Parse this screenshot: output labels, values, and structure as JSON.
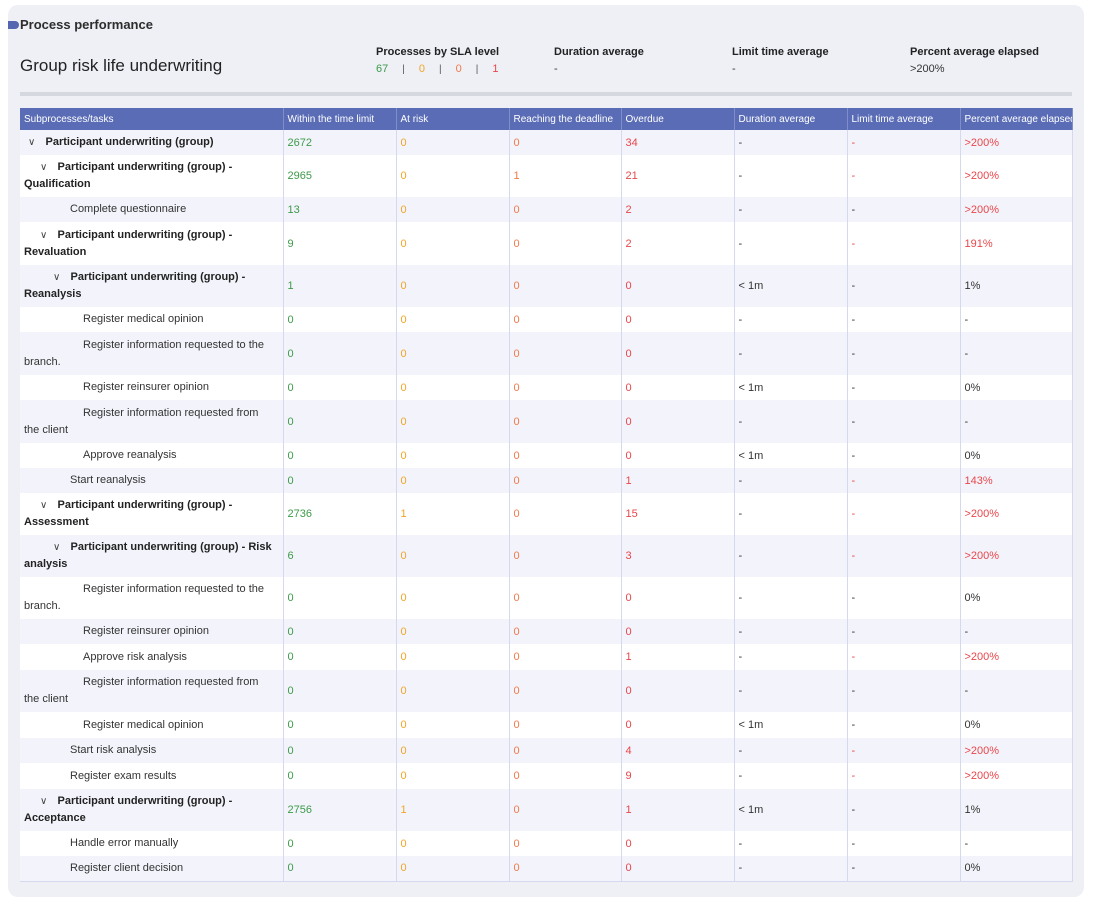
{
  "panel_title": "Process performance",
  "process_name": "Group risk life underwriting",
  "summary": {
    "sla_label": "Processes by SLA level",
    "sla_values": [
      "67",
      "0",
      "0",
      "1"
    ],
    "sla_separator": "|",
    "duration_label": "Duration average",
    "duration_value": "-",
    "limit_label": "Limit time average",
    "limit_value": "-",
    "percent_label": "Percent average elapsed",
    "percent_value": ">200%"
  },
  "colors": {
    "header_bg": "#5a6cb6",
    "within": "#3d9a4a",
    "at_risk": "#f0a526",
    "reaching": "#ef7a4a",
    "overdue": "#e8464a"
  },
  "columns": [
    "Subprocesses/tasks",
    "Within the time limit",
    "At risk",
    "Reaching the deadline",
    "Overdue",
    "Duration average",
    "Limit time average",
    "Percent average elapsed"
  ],
  "rows": [
    {
      "level": 0,
      "group": true,
      "name1": "Participant underwriting (group)",
      "name2": "",
      "within": "2672",
      "risk": "0",
      "reach": "0",
      "overdue": "34",
      "dur": "-",
      "limit": "-",
      "pct": ">200%",
      "limit_red": true,
      "pct_red": true,
      "h": 25
    },
    {
      "level": 1,
      "group": true,
      "name1": "Participant underwriting (group) -",
      "name2": "Qualification",
      "within": "2965",
      "risk": "0",
      "reach": "1",
      "overdue": "21",
      "dur": "-",
      "limit": "-",
      "pct": ">200%",
      "limit_red": true,
      "pct_red": true,
      "h": 42
    },
    {
      "level": 2,
      "group": false,
      "name1": "Complete questionnaire",
      "name2": "",
      "within": "13",
      "risk": "0",
      "reach": "0",
      "overdue": "2",
      "dur": "-",
      "limit": "-",
      "pct": ">200%",
      "limit_red": false,
      "pct_red": true,
      "h": 25
    },
    {
      "level": 1,
      "group": true,
      "name1": "Participant underwriting (group) -",
      "name2": "Revaluation",
      "within": "9",
      "risk": "0",
      "reach": "0",
      "overdue": "2",
      "dur": "-",
      "limit": "-",
      "pct": "191%",
      "limit_red": true,
      "pct_red": true,
      "h": 43
    },
    {
      "level": 2,
      "group": true,
      "name1": "Participant underwriting (group) -",
      "name2": "Reanalysis",
      "within": "1",
      "risk": "0",
      "reach": "0",
      "overdue": "0",
      "dur": "< 1m",
      "limit": "-",
      "pct": "1%",
      "limit_red": false,
      "pct_red": false,
      "h": 42
    },
    {
      "level": 3,
      "group": false,
      "name1": "Register medical opinion",
      "name2": "",
      "within": "0",
      "risk": "0",
      "reach": "0",
      "overdue": "0",
      "dur": "-",
      "limit": "-",
      "pct": "-",
      "limit_red": false,
      "pct_red": false,
      "h": 25
    },
    {
      "level": 3,
      "group": false,
      "name1": "Register information requested to the",
      "name2": "branch.",
      "within": "0",
      "risk": "0",
      "reach": "0",
      "overdue": "0",
      "dur": "-",
      "limit": "-",
      "pct": "-",
      "limit_red": false,
      "pct_red": false,
      "h": 43
    },
    {
      "level": 3,
      "group": false,
      "name1": "Register reinsurer opinion",
      "name2": "",
      "within": "0",
      "risk": "0",
      "reach": "0",
      "overdue": "0",
      "dur": "< 1m",
      "limit": "-",
      "pct": "0%",
      "limit_red": false,
      "pct_red": false,
      "h": 25
    },
    {
      "level": 3,
      "group": false,
      "name1": "Register information requested from",
      "name2": "the client",
      "within": "0",
      "risk": "0",
      "reach": "0",
      "overdue": "0",
      "dur": "-",
      "limit": "-",
      "pct": "-",
      "limit_red": false,
      "pct_red": false,
      "h": 43
    },
    {
      "level": 3,
      "group": false,
      "name1": "Approve reanalysis",
      "name2": "",
      "within": "0",
      "risk": "0",
      "reach": "0",
      "overdue": "0",
      "dur": "< 1m",
      "limit": "-",
      "pct": "0%",
      "limit_red": false,
      "pct_red": false,
      "h": 25
    },
    {
      "level": 2,
      "group": false,
      "name1": "Start reanalysis",
      "name2": "",
      "within": "0",
      "risk": "0",
      "reach": "0",
      "overdue": "1",
      "dur": "-",
      "limit": "-",
      "pct": "143%",
      "limit_red": true,
      "pct_red": true,
      "h": 25
    },
    {
      "level": 1,
      "group": true,
      "name1": "Participant underwriting (group) -",
      "name2": "Assessment",
      "within": "2736",
      "risk": "1",
      "reach": "0",
      "overdue": "15",
      "dur": "-",
      "limit": "-",
      "pct": ">200%",
      "limit_red": true,
      "pct_red": true,
      "h": 42
    },
    {
      "level": 2,
      "group": true,
      "name1": "Participant underwriting (group) - Risk",
      "name2": "analysis",
      "within": "6",
      "risk": "0",
      "reach": "0",
      "overdue": "3",
      "dur": "-",
      "limit": "-",
      "pct": ">200%",
      "limit_red": true,
      "pct_red": true,
      "h": 42
    },
    {
      "level": 3,
      "group": false,
      "name1": "Register information requested to the",
      "name2": "branch.",
      "within": "0",
      "risk": "0",
      "reach": "0",
      "overdue": "0",
      "dur": "-",
      "limit": "-",
      "pct": "0%",
      "limit_red": false,
      "pct_red": false,
      "h": 42
    },
    {
      "level": 3,
      "group": false,
      "name1": "Register reinsurer opinion",
      "name2": "",
      "within": "0",
      "risk": "0",
      "reach": "0",
      "overdue": "0",
      "dur": "-",
      "limit": "-",
      "pct": "-",
      "limit_red": false,
      "pct_red": false,
      "h": 25
    },
    {
      "level": 3,
      "group": false,
      "name1": "Approve risk analysis",
      "name2": "",
      "within": "0",
      "risk": "0",
      "reach": "0",
      "overdue": "1",
      "dur": "-",
      "limit": "-",
      "pct": ">200%",
      "limit_red": true,
      "pct_red": true,
      "h": 26
    },
    {
      "level": 3,
      "group": false,
      "name1": "Register information requested from",
      "name2": "the client",
      "within": "0",
      "risk": "0",
      "reach": "0",
      "overdue": "0",
      "dur": "-",
      "limit": "-",
      "pct": "-",
      "limit_red": false,
      "pct_red": false,
      "h": 42
    },
    {
      "level": 3,
      "group": false,
      "name1": "Register medical opinion",
      "name2": "",
      "within": "0",
      "risk": "0",
      "reach": "0",
      "overdue": "0",
      "dur": "< 1m",
      "limit": "-",
      "pct": "0%",
      "limit_red": false,
      "pct_red": false,
      "h": 26
    },
    {
      "level": 2,
      "group": false,
      "name1": "Start risk analysis",
      "name2": "",
      "within": "0",
      "risk": "0",
      "reach": "0",
      "overdue": "4",
      "dur": "-",
      "limit": "-",
      "pct": ">200%",
      "limit_red": true,
      "pct_red": true,
      "h": 25
    },
    {
      "level": 2,
      "group": false,
      "name1": "Register exam results",
      "name2": "",
      "within": "0",
      "risk": "0",
      "reach": "0",
      "overdue": "9",
      "dur": "-",
      "limit": "-",
      "pct": ">200%",
      "limit_red": true,
      "pct_red": true,
      "h": 26
    },
    {
      "level": 1,
      "group": true,
      "name1": "Participant underwriting (group) -",
      "name2": "Acceptance",
      "within": "2756",
      "risk": "1",
      "reach": "0",
      "overdue": "1",
      "dur": "< 1m",
      "limit": "-",
      "pct": "1%",
      "limit_red": false,
      "pct_red": false,
      "h": 42
    },
    {
      "level": 2,
      "group": false,
      "name1": "Handle error manually",
      "name2": "",
      "within": "0",
      "risk": "0",
      "reach": "0",
      "overdue": "0",
      "dur": "-",
      "limit": "-",
      "pct": "-",
      "limit_red": false,
      "pct_red": false,
      "h": 25
    },
    {
      "level": 2,
      "group": false,
      "name1": "Register client decision",
      "name2": "",
      "within": "0",
      "risk": "0",
      "reach": "0",
      "overdue": "0",
      "dur": "-",
      "limit": "-",
      "pct": "0%",
      "limit_red": false,
      "pct_red": false,
      "h": 25
    }
  ]
}
